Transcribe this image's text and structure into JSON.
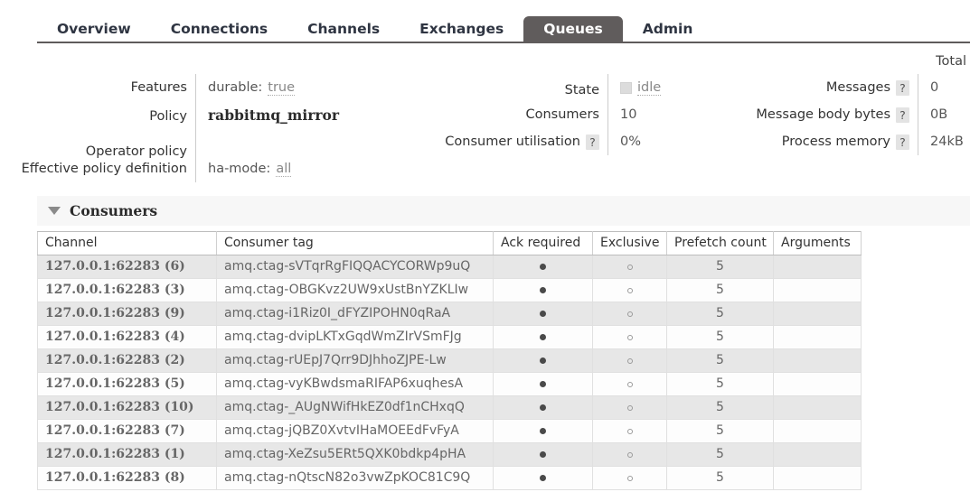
{
  "nav": {
    "tabs": [
      {
        "label": "Overview",
        "active": false
      },
      {
        "label": "Connections",
        "active": false
      },
      {
        "label": "Channels",
        "active": false
      },
      {
        "label": "Exchanges",
        "active": false
      },
      {
        "label": "Queues",
        "active": true
      },
      {
        "label": "Admin",
        "active": false
      }
    ]
  },
  "details": {
    "group1": {
      "rows": [
        {
          "label": "Features",
          "value": "durable:",
          "value_dim": "true",
          "style": "plain"
        },
        {
          "label": "Policy",
          "value": "rabbitmq_mirror",
          "value_dim": "",
          "style": "bold"
        },
        {
          "label": "Operator policy",
          "value": "",
          "value_dim": "",
          "style": "plain"
        },
        {
          "label": "Effective policy definition",
          "value": "ha-mode:",
          "value_dim": "all",
          "style": "plain"
        }
      ]
    },
    "group2": {
      "rows": [
        {
          "label": "State",
          "help": false,
          "square": true,
          "value": "",
          "value_dim": "idle"
        },
        {
          "label": "Consumers",
          "help": false,
          "square": false,
          "value": "10",
          "value_dim": ""
        },
        {
          "label": "Consumer utilisation",
          "help": true,
          "square": false,
          "value": "0%",
          "value_dim": ""
        }
      ]
    },
    "group3": {
      "title": "Total",
      "rows": [
        {
          "label": "Messages",
          "help": true,
          "value": "0"
        },
        {
          "label": "Message body bytes",
          "help": true,
          "value": "0B"
        },
        {
          "label": "Process memory",
          "help": true,
          "value": "24kB"
        }
      ]
    },
    "help_glyph": "?"
  },
  "consumers_section": {
    "title": "Consumers",
    "caret": "caret-down-icon",
    "columns": [
      "Channel",
      "Consumer tag",
      "Ack required",
      "Exclusive",
      "Prefetch count",
      "Arguments"
    ],
    "rows": [
      {
        "channel": "127.0.0.1:62283 (6)",
        "tag": "amq.ctag-sVTqrRgFIQQACYCORWp9uQ",
        "ack": "●",
        "exclusive": "○",
        "prefetch": "5",
        "arguments": ""
      },
      {
        "channel": "127.0.0.1:62283 (3)",
        "tag": "amq.ctag-OBGKvz2UW9xUstBnYZKLIw",
        "ack": "●",
        "exclusive": "○",
        "prefetch": "5",
        "arguments": ""
      },
      {
        "channel": "127.0.0.1:62283 (9)",
        "tag": "amq.ctag-i1Riz0I_dFYZIPOHN0qRaA",
        "ack": "●",
        "exclusive": "○",
        "prefetch": "5",
        "arguments": ""
      },
      {
        "channel": "127.0.0.1:62283 (4)",
        "tag": "amq.ctag-dvipLKTxGqdWmZIrVSmFJg",
        "ack": "●",
        "exclusive": "○",
        "prefetch": "5",
        "arguments": ""
      },
      {
        "channel": "127.0.0.1:62283 (2)",
        "tag": "amq.ctag-rUEpJ7Qrr9DJhhoZJPE-Lw",
        "ack": "●",
        "exclusive": "○",
        "prefetch": "5",
        "arguments": ""
      },
      {
        "channel": "127.0.0.1:62283 (5)",
        "tag": "amq.ctag-vyKBwdsmaRIFAP6xuqhesA",
        "ack": "●",
        "exclusive": "○",
        "prefetch": "5",
        "arguments": ""
      },
      {
        "channel": "127.0.0.1:62283 (10)",
        "tag": "amq.ctag-_AUgNWifHkEZ0df1nCHxqQ",
        "ack": "●",
        "exclusive": "○",
        "prefetch": "5",
        "arguments": ""
      },
      {
        "channel": "127.0.0.1:62283 (7)",
        "tag": "amq.ctag-jQBZ0XvtvIHaMOEEdFvFyA",
        "ack": "●",
        "exclusive": "○",
        "prefetch": "5",
        "arguments": ""
      },
      {
        "channel": "127.0.0.1:62283 (1)",
        "tag": "amq.ctag-XeZsu5ERt5QXK0bdkp4pHA",
        "ack": "●",
        "exclusive": "○",
        "prefetch": "5",
        "arguments": ""
      },
      {
        "channel": "127.0.0.1:62283 (8)",
        "tag": "amq.ctag-nQtscN82o3vwZpKOC81C9Q",
        "ack": "●",
        "exclusive": "○",
        "prefetch": "5",
        "arguments": ""
      }
    ]
  },
  "colors": {
    "active_tab_bg": "#605c5c",
    "nav_text": "#2f3542",
    "band_bg": "#f7f7f7",
    "row_shaded": "#e7e7e7",
    "help_badge_bg": "#e3e3e3",
    "state_square": "#dcdcdc"
  }
}
